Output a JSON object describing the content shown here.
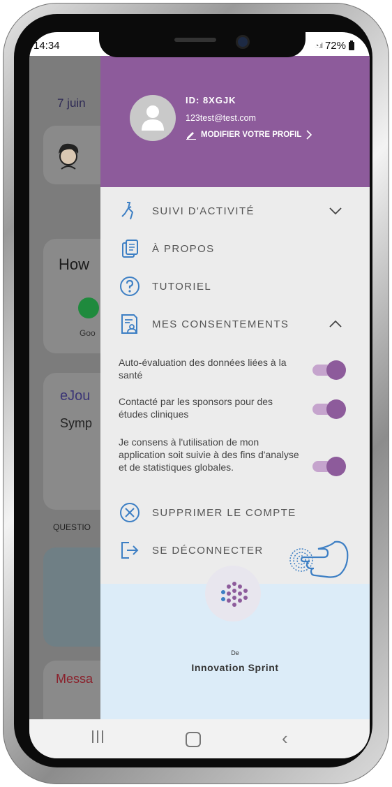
{
  "status_bar": {
    "time": "14:34",
    "battery": "72%"
  },
  "background_app": {
    "date": "7 juin",
    "card_title": "How",
    "mood_label": "Goo",
    "journal_title": "eJou",
    "journal_sub": "Symp",
    "section": "QUESTIO",
    "messages": "Messa"
  },
  "profile": {
    "id": "ID: 8XGJK",
    "email": "123test@test.com",
    "edit_label": "MODIFIER VOTRE PROFIL"
  },
  "menu": {
    "activity": "SUIVI D'ACTIVITÉ",
    "about": "À PROPOS",
    "tutorial": "TUTORIEL",
    "consents": "MES CONSENTEMENTS",
    "delete": "SUPPRIMER LE COMPTE",
    "logout": "SE DÉCONNECTER"
  },
  "consents": [
    {
      "label": "Auto-évaluation des données liées à la santé",
      "enabled": true
    },
    {
      "label": "Contacté par les sponsors pour des études cliniques",
      "enabled": true
    },
    {
      "label": "Je consens à l'utilisation de mon application soit suivie à des fins d'analyse et de statistiques globales.",
      "enabled": true
    }
  ],
  "footer": {
    "by": "De",
    "brand": "Innovation Sprint"
  },
  "colors": {
    "primary": "#8d5b9b",
    "icon_blue": "#3d7fc4",
    "footer_bg": "#dcecf8"
  }
}
